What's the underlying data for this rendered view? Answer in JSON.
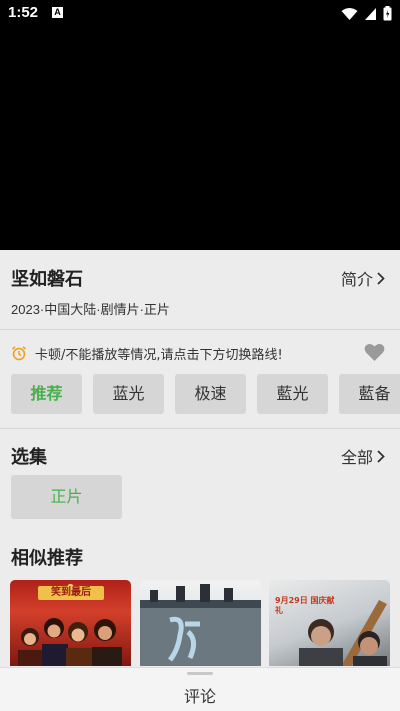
{
  "status_bar": {
    "time": "1:52",
    "notification_icon": "A"
  },
  "movie": {
    "title": "坚如磐石",
    "intro_label": "简介",
    "meta": "2023·中国大陆·剧情片·正片"
  },
  "notice": {
    "text": "卡顿/不能播放等情况,请点击下方切换路线!"
  },
  "lines": [
    {
      "label": "推荐",
      "active": true
    },
    {
      "label": "蓝光",
      "active": false
    },
    {
      "label": "极速",
      "active": false
    },
    {
      "label": "藍光",
      "active": false
    },
    {
      "label": "藍备",
      "active": false
    }
  ],
  "episodes": {
    "title": "选集",
    "all_label": "全部",
    "items": [
      "正片"
    ]
  },
  "similar": {
    "title": "相似推荐",
    "posters": [
      {
        "name": "poster-1",
        "text": "笑到最后"
      },
      {
        "name": "poster-2",
        "text": ""
      },
      {
        "name": "poster-3",
        "text": "9月29日 国庆献礼"
      }
    ]
  },
  "bottom": {
    "comment_label": "评论"
  },
  "colors": {
    "accent": "#46b04a",
    "background": "#ececec",
    "button": "#d6d6d6",
    "notice_icon": "#f0a020"
  }
}
